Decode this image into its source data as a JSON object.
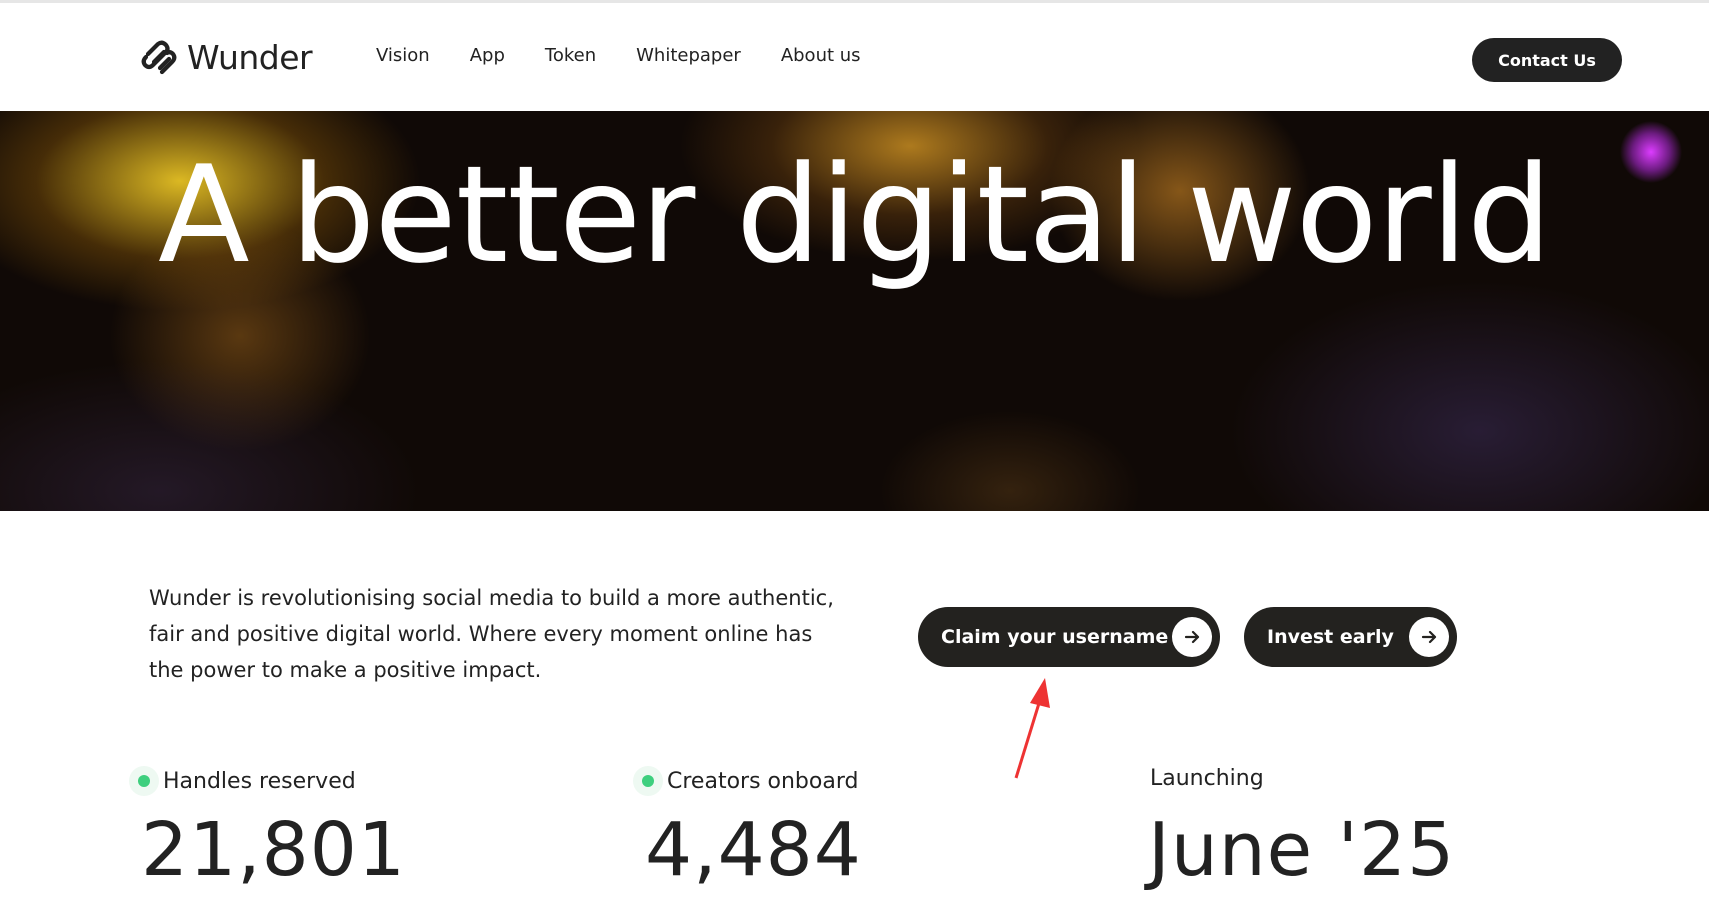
{
  "brand": {
    "name": "Wunder",
    "logo_icon": "wunder-logo-icon"
  },
  "nav": {
    "items": [
      {
        "label": "Vision"
      },
      {
        "label": "App"
      },
      {
        "label": "Token"
      },
      {
        "label": "Whitepaper"
      },
      {
        "label": "About us"
      }
    ],
    "contact_label": "Contact Us"
  },
  "hero": {
    "title": "A better digital world"
  },
  "intro": {
    "text": "Wunder is revolutionising social media to build a more authentic, fair and positive digital world. Where every moment online has the power to make a positive impact."
  },
  "cta": {
    "claim_label": "Claim your username",
    "invest_label": "Invest early",
    "arrow_icon": "arrow-right-icon"
  },
  "stats": [
    {
      "label": "Handles reserved",
      "value": "21,801",
      "live": true
    },
    {
      "label": "Creators onboard",
      "value": "4,484",
      "live": true
    },
    {
      "label": "Launching",
      "value": "June '25",
      "live": false
    }
  ],
  "colors": {
    "text": "#222222",
    "button_bg": "#23221f",
    "live_dot": "#3ecf7e",
    "annotation_arrow": "#ee3333"
  }
}
